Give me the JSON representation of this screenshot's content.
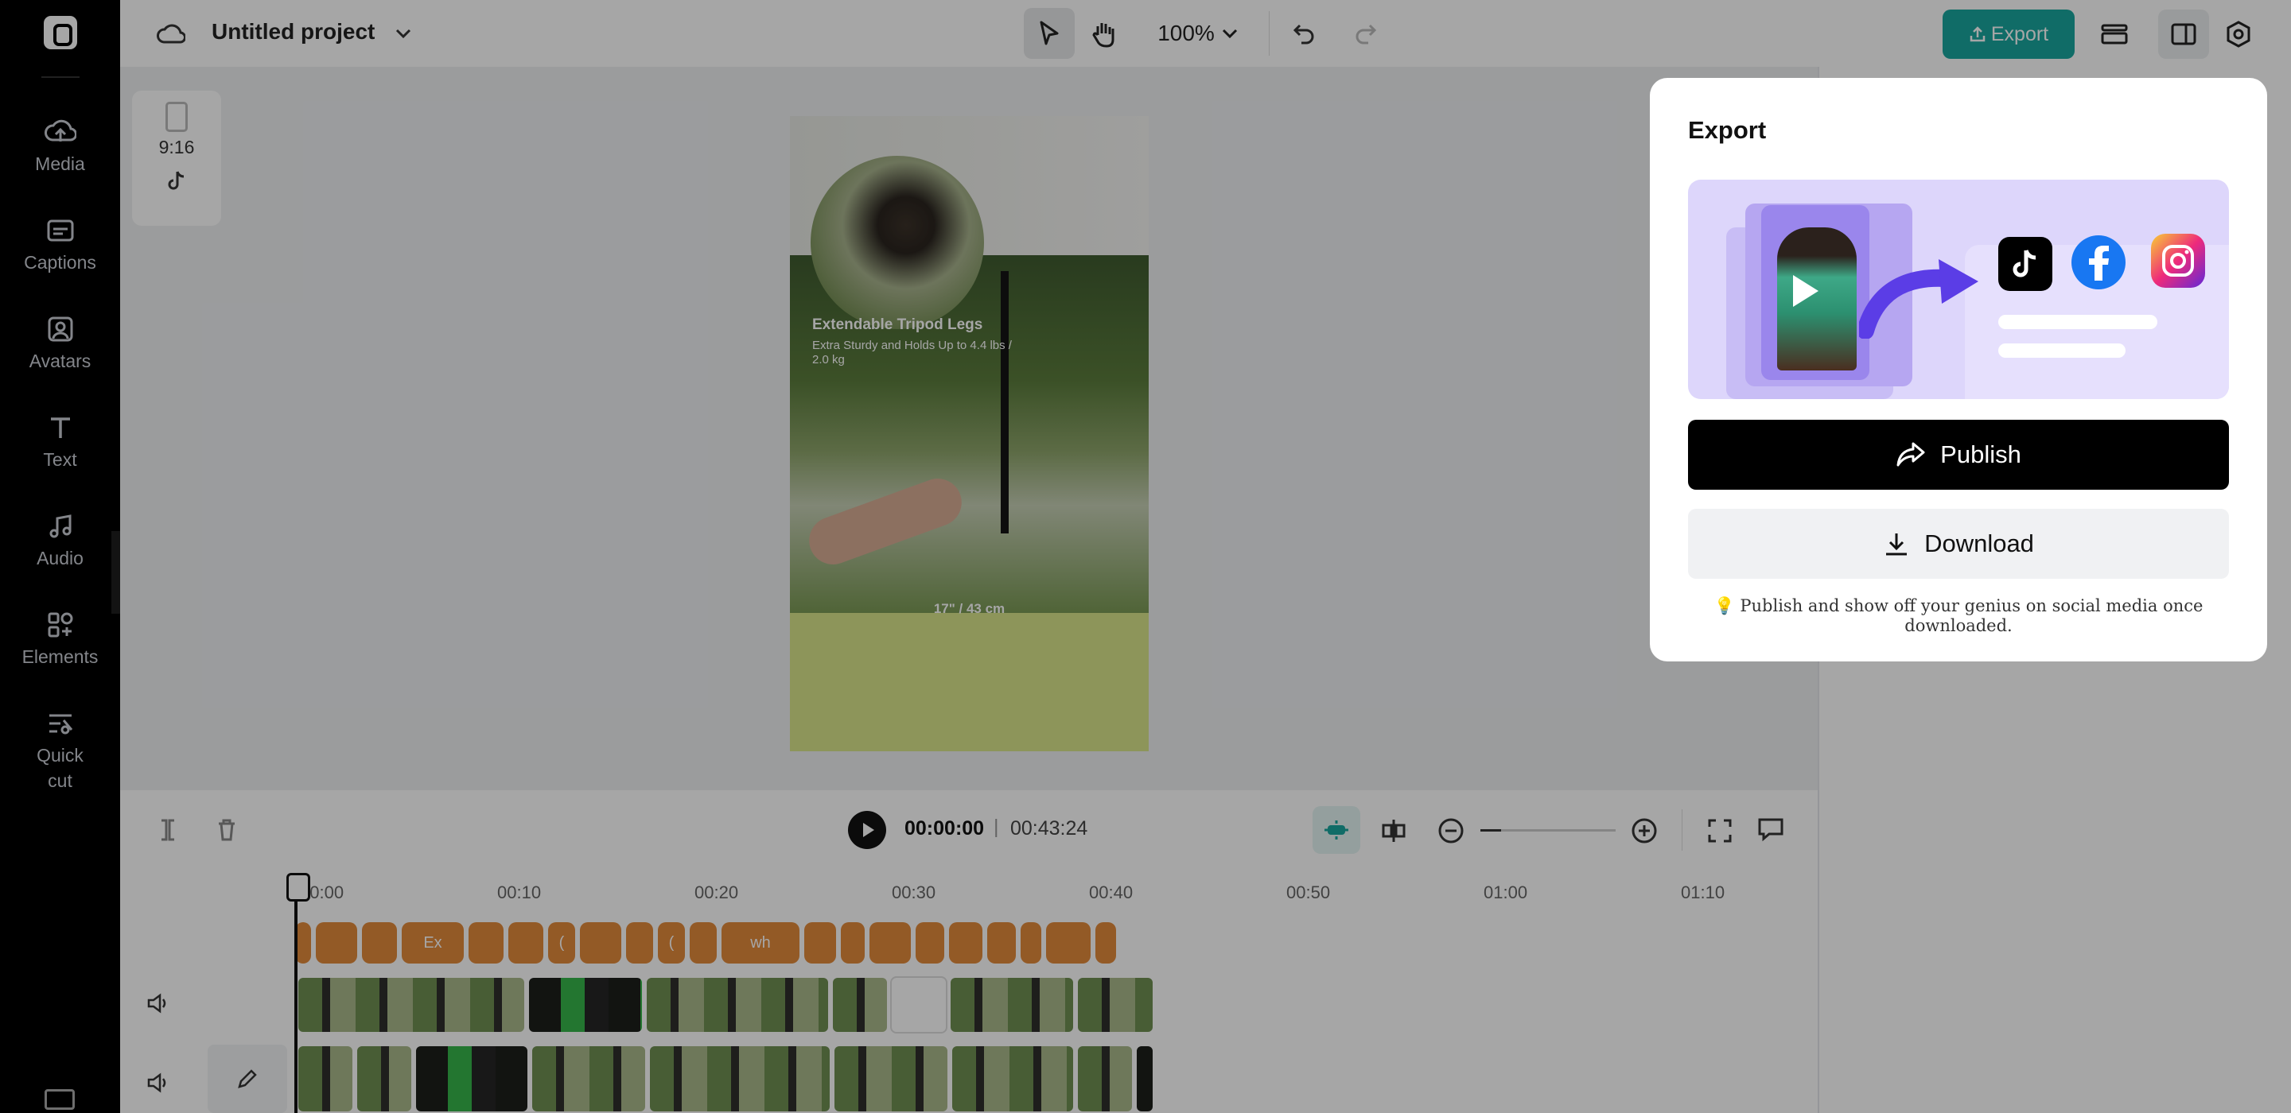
{
  "app": {
    "project_title": "Untitled project",
    "zoom_level": "100%",
    "export_label": "Export"
  },
  "sidebar": {
    "items": [
      {
        "label": "Media"
      },
      {
        "label": "Captions"
      },
      {
        "label": "Avatars"
      },
      {
        "label": "Text"
      },
      {
        "label": "Audio"
      },
      {
        "label": "Elements"
      },
      {
        "label": "Quick cut"
      }
    ]
  },
  "canvas_panel": {
    "ratio": "9:16"
  },
  "canvas": {
    "caption_title": "Extendable Tripod Legs",
    "caption_sub": "Extra Sturdy and Holds Up to 4.4 lbs / 2.0 kg",
    "measurement": "17\" / 43 cm"
  },
  "timeline": {
    "current_time": "00:00:00",
    "total_time": "00:43:24",
    "separator": "|",
    "ticks": [
      "00:00",
      "00:10",
      "00:20",
      "00:30",
      "00:40",
      "00:50",
      "01:00",
      "01:10"
    ],
    "caption_clips": [
      "",
      "",
      "",
      "Ex",
      "",
      "",
      "(",
      "",
      "",
      "(",
      "",
      "wh",
      "",
      "",
      "",
      "",
      "",
      "",
      "",
      "",
      ""
    ]
  },
  "export_popover": {
    "title": "Export",
    "publish_label": "Publish",
    "download_label": "Download",
    "tip": "💡 Publish and show off your genius on social media once downloaded."
  },
  "colors": {
    "accent": "#1aa79f",
    "caption_clip": "#e28a3b",
    "publish_bg": "#000000"
  },
  "icons": [
    "logo-icon",
    "cloud-icon",
    "chevron-down-icon",
    "pointer-icon",
    "hand-icon",
    "undo-icon",
    "redo-icon",
    "layers-icon",
    "panel-icon",
    "settings-icon",
    "tiktok-icon",
    "facebook-icon",
    "instagram-icon",
    "share-icon",
    "download-icon"
  ]
}
